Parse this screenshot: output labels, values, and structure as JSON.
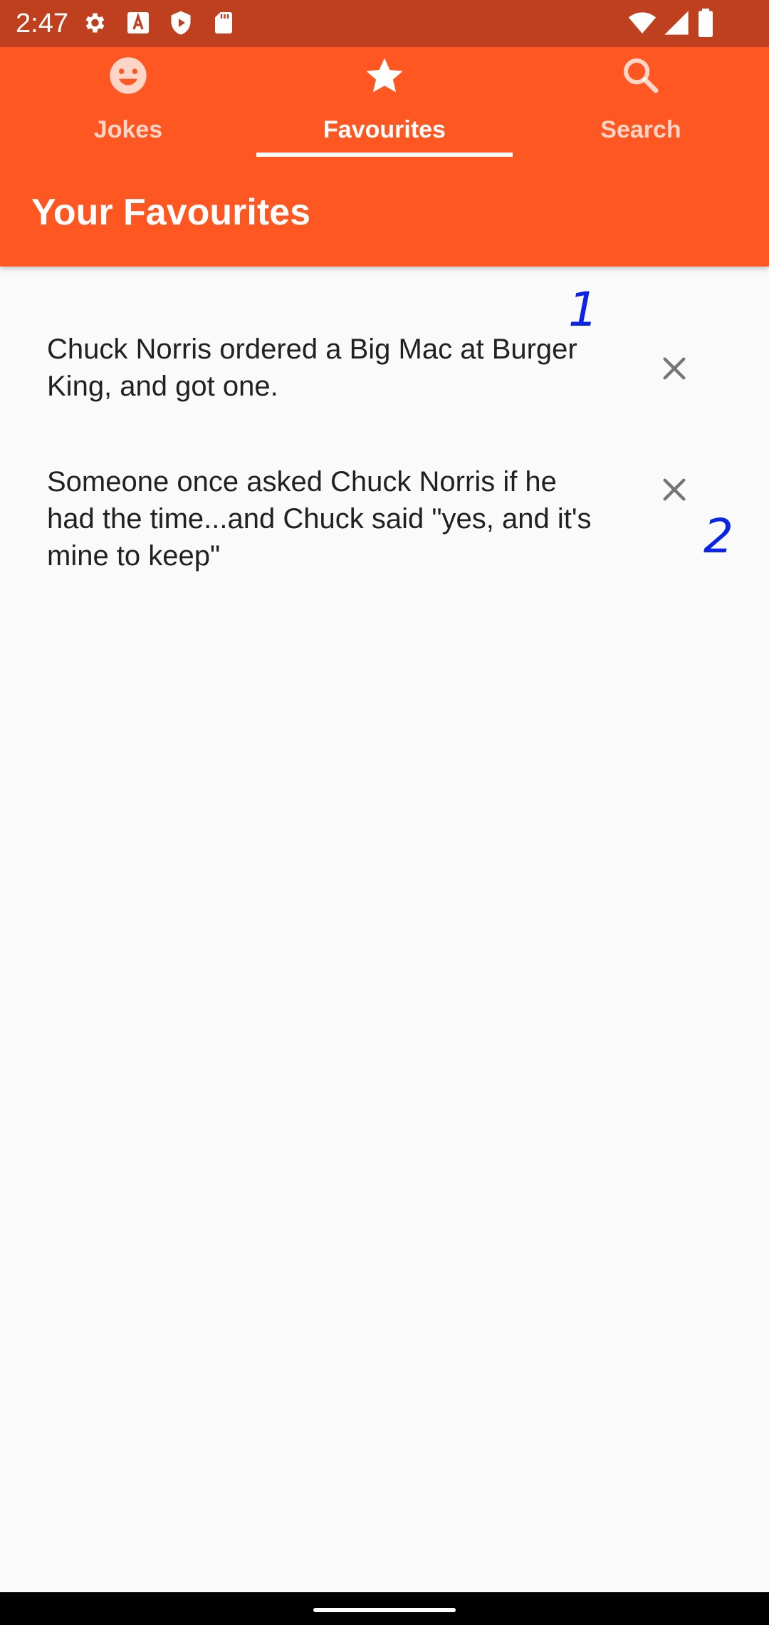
{
  "status_bar": {
    "time": "2:47",
    "icons": [
      "gear-icon",
      "font-a-icon",
      "shield-play-icon",
      "sd-card-icon",
      "wifi-icon",
      "signal-icon",
      "battery-icon"
    ]
  },
  "tabs": [
    {
      "label": "Jokes",
      "icon": "smiley-icon",
      "active": false
    },
    {
      "label": "Favourites",
      "icon": "star-icon",
      "active": true
    },
    {
      "label": "Search",
      "icon": "search-icon",
      "active": false
    }
  ],
  "appbar": {
    "title": "Your Favourites"
  },
  "favourites": [
    {
      "text": "Chuck Norris ordered a Big Mac at Burger King, and got one.",
      "remove_icon": "close-icon",
      "marker": "1"
    },
    {
      "text": "Someone once asked Chuck Norris if he had the time...and Chuck said \"yes, and it's mine to keep\"",
      "remove_icon": "close-icon",
      "marker": "2"
    }
  ],
  "colors": {
    "primary": "#ff5722",
    "status_bar": "#bf401f",
    "background": "#fafafa",
    "text": "#212121",
    "icon_grey": "#757575",
    "annotation": "#0a24e8"
  }
}
